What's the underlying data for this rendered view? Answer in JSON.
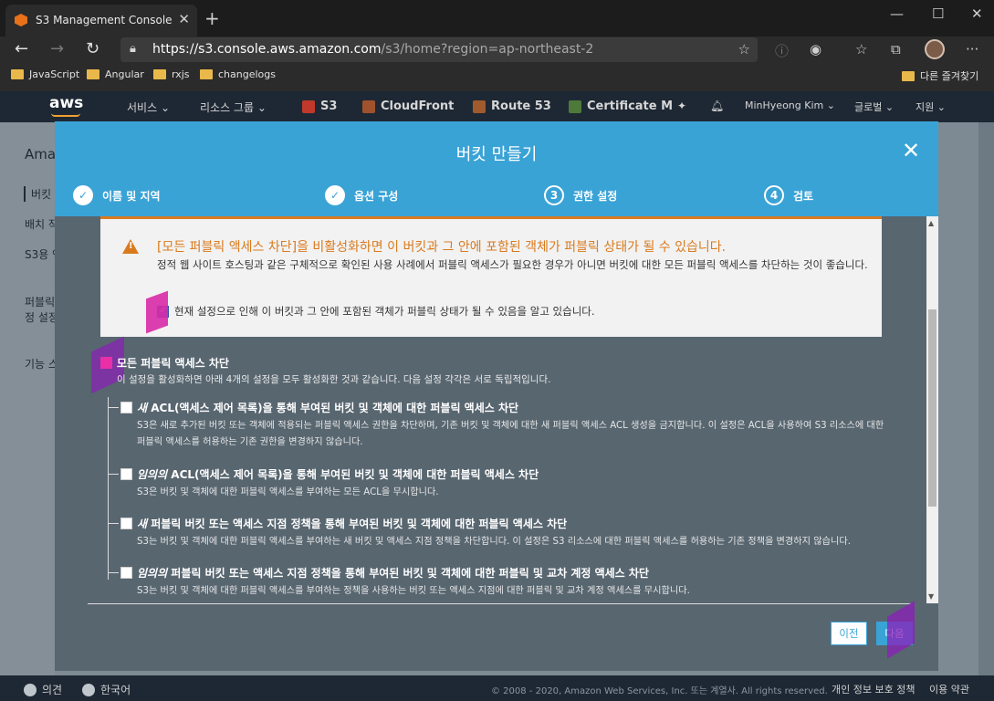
{
  "browser": {
    "tab_title": "S3 Management Console",
    "url_main": "https://s3.console.aws.amazon.com",
    "url_rest": "/s3/home?region=ap-northeast-2",
    "bookmarks": [
      "JavaScript",
      "Angular",
      "rxjs",
      "changelogs"
    ],
    "other_bookmarks": "다른 즐겨찾기"
  },
  "aws_nav": {
    "logo": "aws",
    "services": "서비스",
    "resource_groups": "리소스 그룹",
    "pinned": [
      "S3",
      "CloudFront",
      "Route 53",
      "Certificate M"
    ],
    "user": "MinHyeong Kim",
    "region": "글로벌",
    "support": "지원"
  },
  "background_page": {
    "items": [
      "Ama",
      "버킷",
      "배치 작",
      "S3용 액",
      "퍼블릭",
      "정 설정",
      "기능 스"
    ]
  },
  "modal": {
    "title": "버킷 만들기",
    "steps": [
      {
        "num": "1",
        "label": "이름 및 지역",
        "done": true
      },
      {
        "num": "2",
        "label": "옵션 구성",
        "done": true
      },
      {
        "num": "3",
        "label": "권한 설정",
        "done": false
      },
      {
        "num": "4",
        "label": "검토",
        "done": false
      }
    ],
    "warning": {
      "title": "[모든 퍼블릭 액세스 차단]을 비활성화하면 이 버킷과 그 안에 포함된 객체가 퍼블릭 상태가 될 수 있습니다.",
      "desc": "정적 웹 사이트 호스팅과 같은 구체적으로 확인된 사용 사례에서 퍼블릭 액세스가 필요한 경우가 아니면 버킷에 대한 모든 퍼블릭 액세스를 차단하는 것이 좋습니다.",
      "ack": "현재 설정으로 인해 이 버킷과 그 안에 포함된 객체가 퍼블릭 상태가 될 수 있음을 알고 있습니다."
    },
    "block_all": {
      "label": "모든 퍼블릭 액세스 차단",
      "sub": "이 설정을 활성화하면 아래 4개의 설정을 모두 활성화한 것과 같습니다. 다음 설정 각각은 서로 독립적입니다."
    },
    "options": [
      {
        "em": "새",
        "label": " ACL(액세스 제어 목록)을 통해 부여된 버킷 및 객체에 대한 퍼블릭 액세스 차단",
        "desc": "S3은 새로 추가된 버킷 또는 객체에 적용되는 퍼블릭 액세스 권한을 차단하며, 기존 버킷 및 객체에 대한 새 퍼블릭 액세스 ACL 생성을 금지합니다. 이 설정은 ACL을 사용하여 S3 리소스에 대한 퍼블릭 액세스를 허용하는 기존 권한을 변경하지 않습니다."
      },
      {
        "em": "임의의",
        "label": " ACL(액세스 제어 목록)을 통해 부여된 버킷 및 객체에 대한 퍼블릭 액세스 차단",
        "desc": "S3은 버킷 및 객체에 대한 퍼블릭 액세스를 부여하는 모든 ACL을 무시합니다."
      },
      {
        "em": "새",
        "label": " 퍼블릭 버킷 또는 액세스 지점 정책을 통해 부여된 버킷 및 객체에 대한 퍼블릭 액세스 차단",
        "desc": "S3는 버킷 및 객체에 대한 퍼블릭 액세스를 부여하는 새 버킷 및 액세스 지점 정책을 차단합니다. 이 설정은 S3 리소스에 대한 퍼블릭 액세스를 허용하는 기존 정책을 변경하지 않습니다."
      },
      {
        "em": "임의의",
        "label": " 퍼블릭 버킷 또는 액세스 지점 정책을 통해 부여된 버킷 및 객체에 대한 퍼블릭 및 교차 계정 액세스 차단",
        "desc": "S3는 버킷 및 객체에 대한 퍼블릭 액세스를 부여하는 정책을 사용하는 버킷 또는 액세스 지점에 대한 퍼블릭 및 교차 계정 액세스를 무시합니다."
      }
    ],
    "prev_button": "이전",
    "next_button": "다음"
  },
  "footer": {
    "feedback": "의견",
    "language": "한국어",
    "copyright": "© 2008 - 2020, Amazon Web Services, Inc. 또는 계열사. All rights reserved.",
    "privacy": "개인 정보 보호 정책",
    "terms": "이용 약관"
  },
  "colors": {
    "accent": "#3aa3d6",
    "warning": "#d97a1e",
    "annotation": "#d82aa6",
    "aws_nav": "#1e2834"
  }
}
